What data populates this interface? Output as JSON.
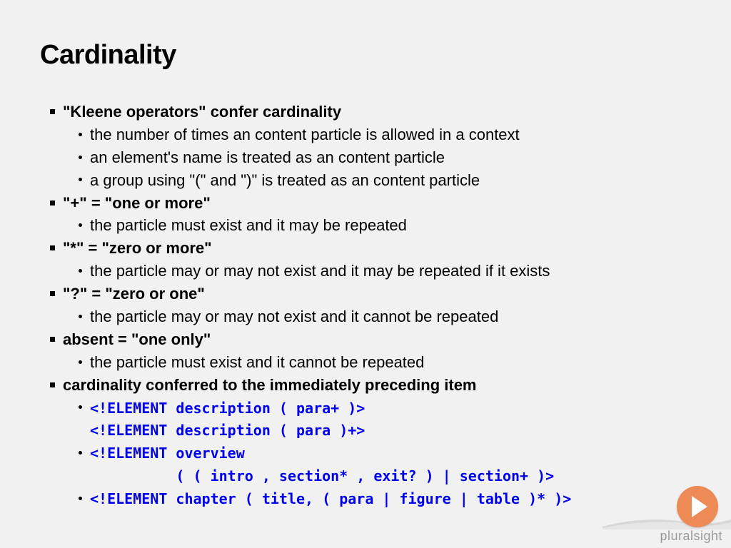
{
  "title": "Cardinality",
  "items": [
    {
      "heading": "\"Kleene operators\" confer cardinality",
      "subs": [
        {
          "type": "text",
          "text": "the number of times an content particle is allowed in a context"
        },
        {
          "type": "text",
          "text": "an element's name is treated as an content particle"
        },
        {
          "type": "text",
          "text": "a group using \"(\" and \")\" is treated as an content particle"
        }
      ]
    },
    {
      "heading": "\"+\" = \"one or more\"",
      "subs": [
        {
          "type": "text",
          "text": "the particle must exist and it may be repeated"
        }
      ]
    },
    {
      "heading": "\"*\" = \"zero or more\"",
      "subs": [
        {
          "type": "text",
          "text": "the particle may or may not exist and it may be repeated if it exists"
        }
      ]
    },
    {
      "heading": "\"?\" = \"zero or one\"",
      "subs": [
        {
          "type": "text",
          "text": "the particle may or may not exist and it cannot be repeated"
        }
      ]
    },
    {
      "heading": "absent = \"one only\"",
      "subs": [
        {
          "type": "text",
          "text": "the particle must exist and it cannot be repeated"
        }
      ]
    },
    {
      "heading": "cardinality conferred to the immediately preceding item",
      "subs": [
        {
          "type": "code",
          "text": "<!ELEMENT description ( para+ )>"
        },
        {
          "type": "code-cont",
          "text": "<!ELEMENT description ( para )+>"
        },
        {
          "type": "code",
          "text": "<!ELEMENT overview"
        },
        {
          "type": "code-cont",
          "text": "          ( ( intro , section* , exit? ) | section+ )>"
        },
        {
          "type": "code",
          "text": "<!ELEMENT chapter ( title, ( para | figure | table )* )>"
        }
      ]
    }
  ],
  "brand": "pluralsight"
}
